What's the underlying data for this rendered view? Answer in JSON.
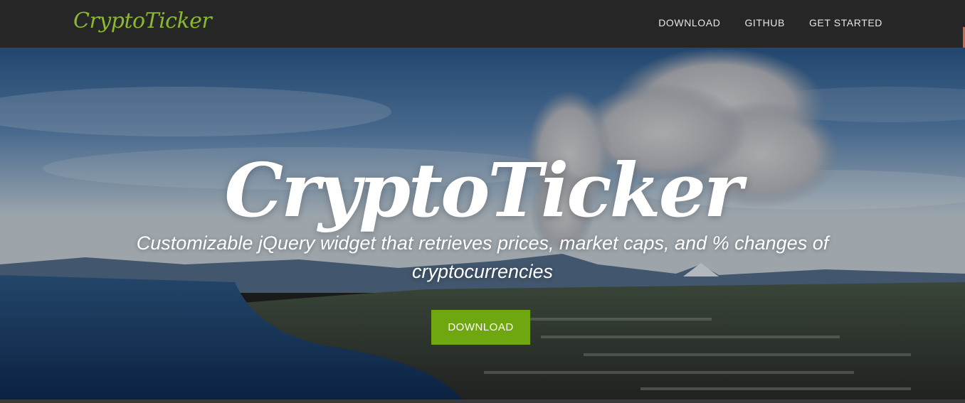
{
  "navbar": {
    "brand": "CryptoTicker",
    "links": [
      "DOWNLOAD",
      "GITHUB",
      "GET STARTED"
    ]
  },
  "hero": {
    "title": "CryptoTicker",
    "subtitle": "Customizable jQuery widget that retrieves prices, market caps, and % changes of cryptocurrencies",
    "button_label": "DOWNLOAD"
  },
  "colors": {
    "navbar_bg": "#262626",
    "brand": "#8ab82e",
    "button_bg": "#6ea70f",
    "text_light": "#ffffff"
  },
  "icons": {
    "hero_background": "volcano-landscape-photo"
  }
}
